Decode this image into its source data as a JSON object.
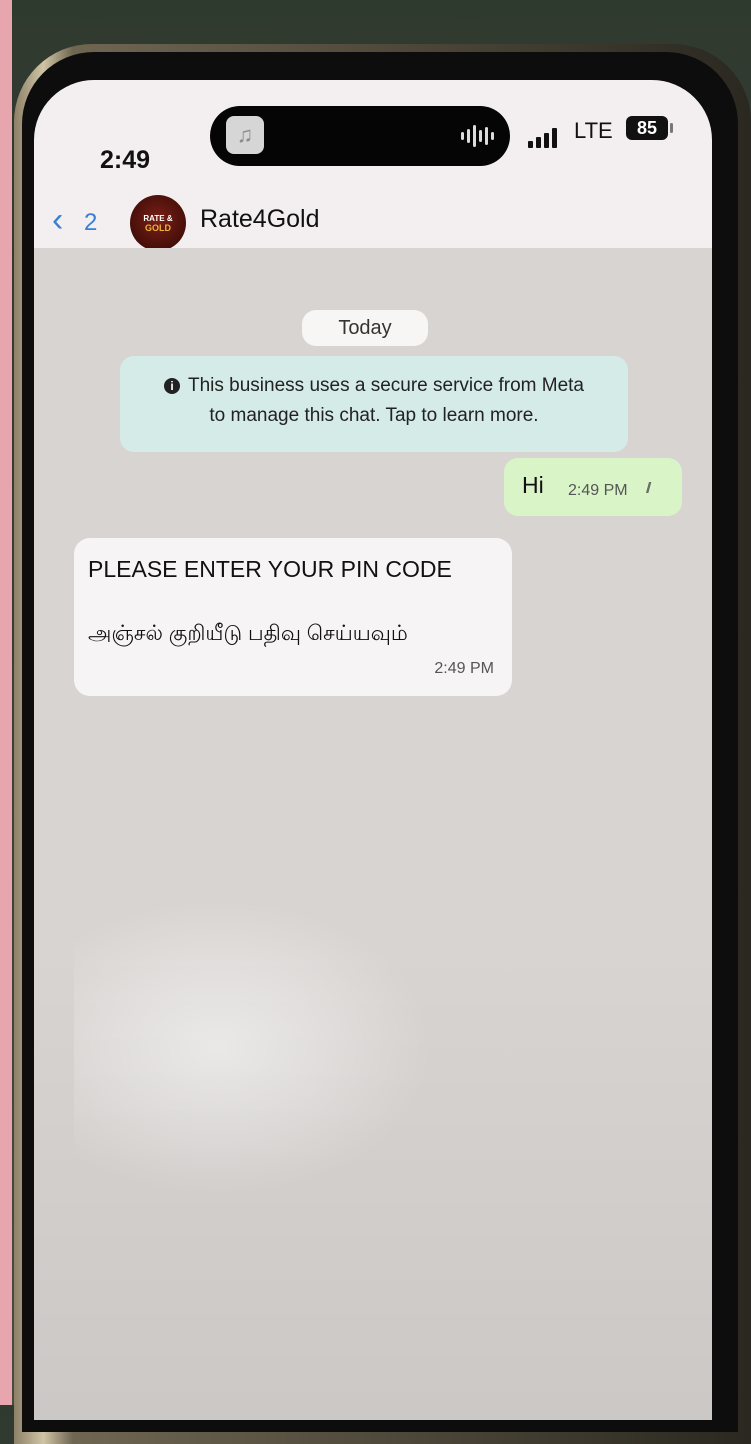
{
  "status_bar": {
    "time": "2:49",
    "network": "LTE",
    "battery": "85",
    "icons": [
      "music-note-icon",
      "audio-wave-icon",
      "signal-icon",
      "battery-icon"
    ]
  },
  "header": {
    "back_count": "2",
    "avatar_text_top": "RATE &",
    "avatar_text_bottom": "GOLD",
    "contact_name": "Rate4Gold"
  },
  "chat": {
    "date_label": "Today",
    "info_banner": {
      "line1": "This business uses a secure service from Meta",
      "line2": "to manage this chat. Tap to learn more."
    },
    "messages": [
      {
        "direction": "outgoing",
        "text": "Hi",
        "time": "2:49 PM",
        "status": "read"
      },
      {
        "direction": "incoming",
        "line1": "PLEASE ENTER YOUR PIN CODE",
        "line2": "அஞ்சல் குறியீடு பதிவு செய்யவும்",
        "time": "2:49 PM"
      }
    ]
  },
  "colors": {
    "accent": "#3b7ed6",
    "outgoing_bubble": "#d9f5c7",
    "incoming_bubble": "#f6f4f4",
    "info_banner": "#d5ebe7",
    "chat_background": "#d8d4d2"
  }
}
